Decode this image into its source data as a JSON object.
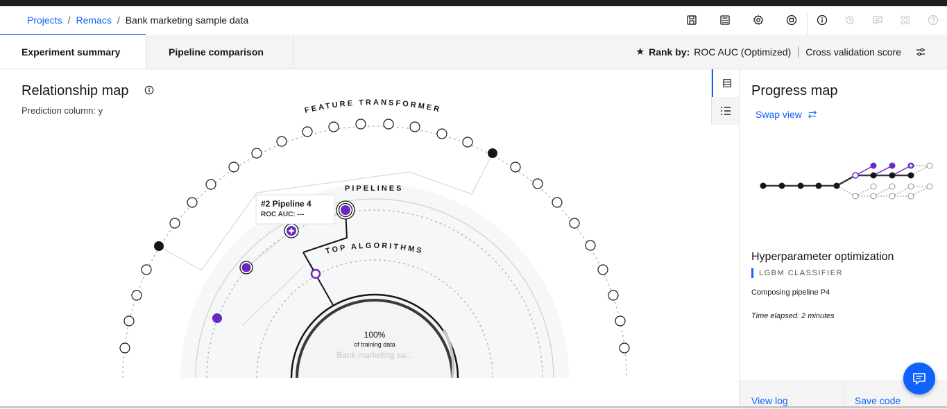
{
  "breadcrumb": {
    "projects": "Projects",
    "remacs": "Remacs",
    "current": "Bank marketing sample data",
    "sep": "/"
  },
  "header_icons": [
    "save-icon",
    "calculator-icon",
    "gear-icon",
    "stop-icon",
    "info-icon",
    "history-icon",
    "comment-icon",
    "apps-icon",
    "help-icon"
  ],
  "tabs": [
    {
      "label": "Experiment summary"
    },
    {
      "label": "Pipeline comparison"
    }
  ],
  "rank": {
    "star": "★",
    "label": "Rank by:",
    "metric": "ROC AUC (Optimized)",
    "score": "Cross validation score"
  },
  "relationship_map": {
    "title": "Relationship map",
    "prediction_label": "Prediction column:",
    "prediction_value": "y",
    "ring_feature": "FEATURE TRANSFORMERS",
    "ring_pipelines": "PIPELINES",
    "ring_algorithms": "TOP ALGORITHMS",
    "center_percent": "100%",
    "center_sub": "of training data",
    "center_name": "Bank marketing sa...",
    "tooltip_title": "#2 Pipeline 4",
    "tooltip_sub": "ROC AUC: ---"
  },
  "progress": {
    "title": "Progress map",
    "swap": "Swap view",
    "phase": "Hyperparameter optimization",
    "algorithm": "LGBM CLASSIFIER",
    "composing": "Composing pipeline P4",
    "elapsed": "Time elapsed: 2 minutes",
    "view_log": "View log",
    "save_code": "Save code"
  },
  "colors": {
    "accent": "#0f62fe",
    "purple": "#6929c4",
    "dark": "#161616"
  }
}
